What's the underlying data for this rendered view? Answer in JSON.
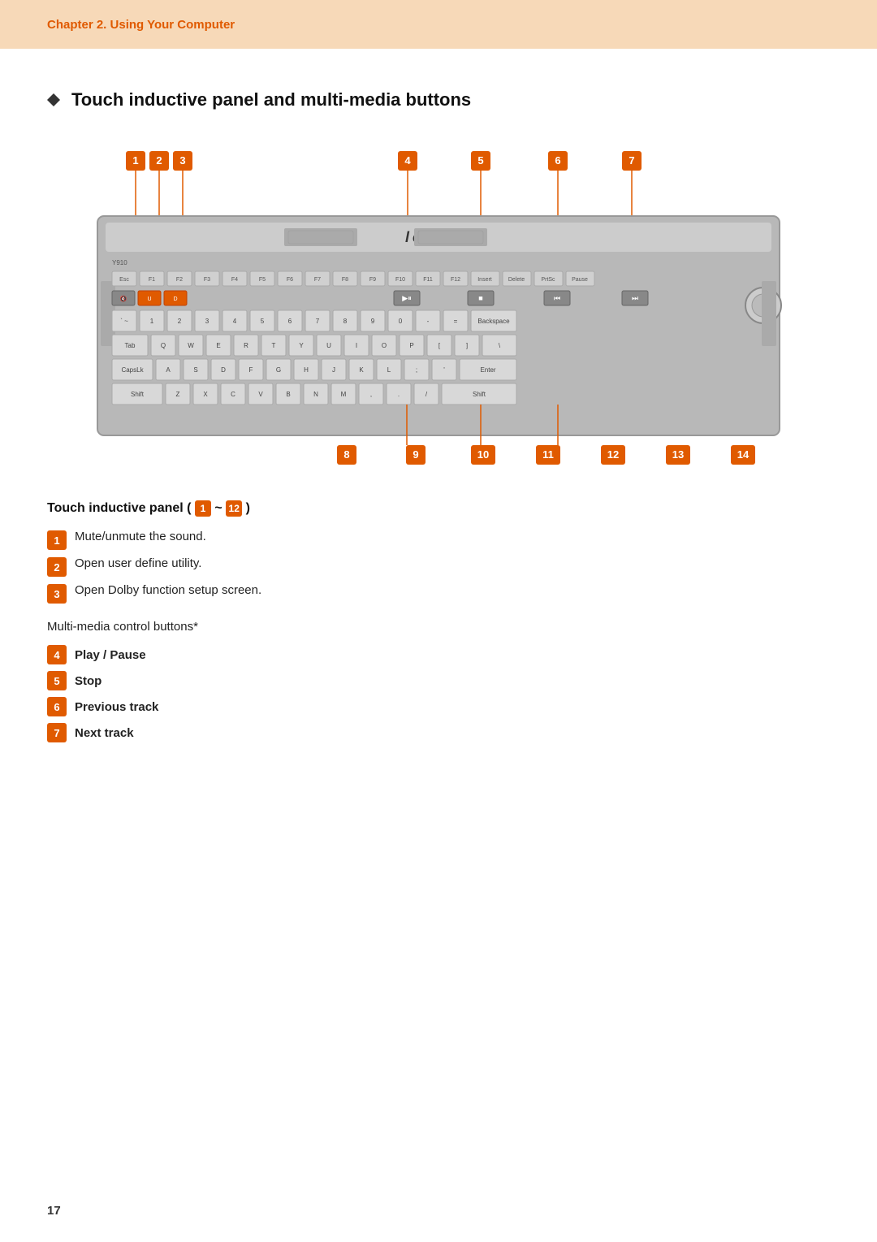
{
  "chapter": {
    "title": "Chapter 2. Using Your Computer"
  },
  "section": {
    "heading": "Touch inductive panel and multi-media buttons"
  },
  "callouts_top": [
    "1",
    "2",
    "3",
    "4",
    "5",
    "6",
    "7"
  ],
  "callouts_bottom": [
    "8",
    "9",
    "10",
    "11",
    "12",
    "13",
    "14"
  ],
  "touch_panel": {
    "title": "Touch inductive panel (",
    "range_start": "1",
    "range_end": "12",
    "title_end": ")",
    "items": [
      {
        "num": "1",
        "text": "Mute/unmute the sound."
      },
      {
        "num": "2",
        "text": "Open user define utility."
      },
      {
        "num": "3",
        "text": "Open Dolby function setup screen."
      }
    ]
  },
  "multimedia": {
    "intro": "Multi-media control buttons*",
    "items": [
      {
        "num": "4",
        "text": "Play / Pause"
      },
      {
        "num": "5",
        "text": "Stop"
      },
      {
        "num": "6",
        "text": "Previous track"
      },
      {
        "num": "7",
        "text": "Next track"
      }
    ]
  },
  "page_number": "17",
  "keyboard": {
    "brand": "lenovo",
    "model": "Y910"
  }
}
